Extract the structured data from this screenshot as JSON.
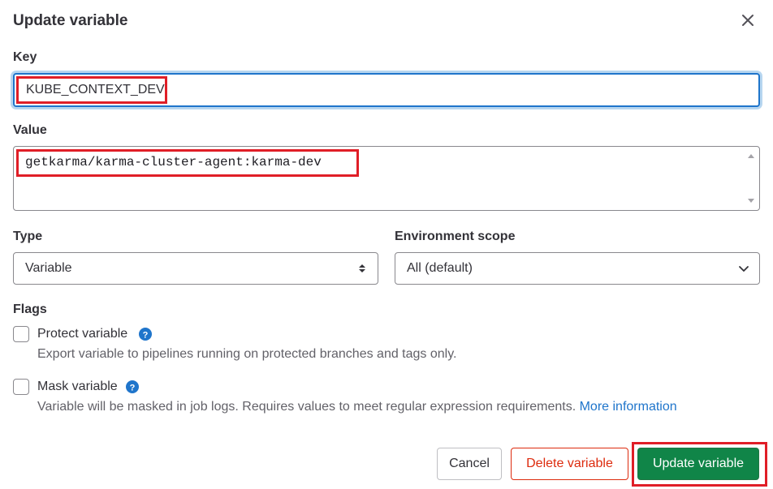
{
  "dialog": {
    "title": "Update variable",
    "close_icon": "close-icon"
  },
  "key": {
    "label": "Key",
    "value": "KUBE_CONTEXT_DEV"
  },
  "value": {
    "label": "Value",
    "text": "getkarma/karma-cluster-agent:karma-dev"
  },
  "type": {
    "label": "Type",
    "selected": "Variable",
    "icon": "sort-arrows-icon"
  },
  "environment_scope": {
    "label": "Environment scope",
    "selected": "All (default)",
    "icon": "chevron-down-icon"
  },
  "flags": {
    "label": "Flags",
    "protect": {
      "label": "Protect variable",
      "description": "Export variable to pipelines running on protected branches and tags only.",
      "checked": false,
      "icon": "question-circle-icon"
    },
    "mask": {
      "label": "Mask variable",
      "description": "Variable will be masked in job logs. Requires values to meet regular expression requirements.",
      "link": "More information",
      "checked": false,
      "icon": "question-circle-icon"
    }
  },
  "buttons": {
    "cancel": "Cancel",
    "delete": "Delete variable",
    "update": "Update variable"
  },
  "colors": {
    "accent_blue": "#1f75cb",
    "danger_red": "#dd2b0e",
    "success_green": "#108548",
    "highlight_red": "#e01e27"
  }
}
